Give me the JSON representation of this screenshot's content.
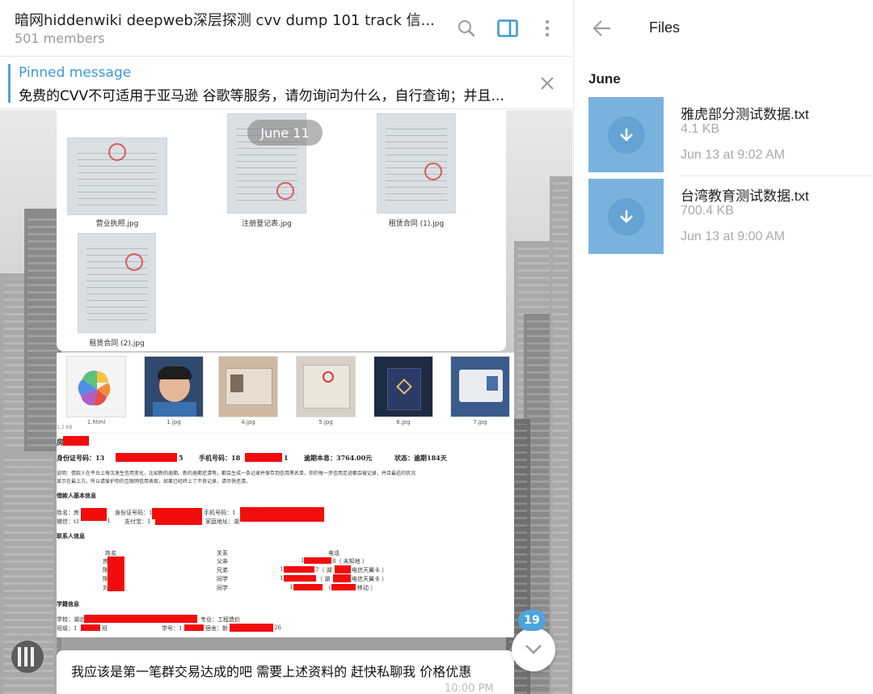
{
  "chat": {
    "title": "暗网hiddenwiki deepweb深层探测 cvv dump 101 track 信...",
    "members": "501 members",
    "pinned_title": "Pinned message",
    "pinned_text": "免费的CVV不可适用于亚马逊 谷歌等服务，请勿询问为什么，自行查询；并且...",
    "date_pill": "June 11",
    "doc_captions": [
      "营业执照.jpg",
      "注册登记表.jpg",
      "租赁合同 (1).jpg",
      "租赁合同 (2).jpg"
    ],
    "strip_captions": [
      "1.html",
      "1.jpg",
      "4.jpg",
      "5.jpg",
      "6.jpg",
      "7.jpg"
    ],
    "strip_size": "1.2 KB",
    "message_text": "我应该是第一笔群交易达成的吧  需要上述资料的 赶快私聊我 价格优惠",
    "message_time": "10:00 PM",
    "unread_count": "19"
  },
  "doc": {
    "id_label": "身份证号码：13",
    "id_tail": "5",
    "phone_label": "手机号码：18",
    "phone_tail": "1",
    "due_label": "逾期本息：3764.00元",
    "status_label": "状态：逾期184天",
    "note_line1": "说明：借款人在平台上每次发生信用变化，比如新的逾期、新的逾期还清等，都会生成一条记录并保存到信用黑名单，你的每一步信用足迹都会被记录，并且最近的状况",
    "note_line2": "显示在最上方。所以请爱护你的互联网信用表现，如果已经终上了不良记录，请尽快还清。",
    "section_basic": "借款人基本信息",
    "basic_row1_a": "姓名：房",
    "basic_row1_b": "身份证号码：1",
    "basic_row1_c": "手机号码：1",
    "basic_row2_a": "微信：t1",
    "basic_row2_b": "1",
    "basic_row2_c": "支付宝：1",
    "basic_row2_d": "家庭地址：湖",
    "section_contacts": "联系人信息",
    "contact_head": [
      "姓名",
      "关系",
      "电话"
    ],
    "contact_rel": [
      "父亲",
      "兄弟",
      "同学",
      "同学"
    ],
    "contact_phone": [
      {
        "pre": "1",
        "post": "8（ 未知地 ）"
      },
      {
        "pre": "1",
        "post": "7（ 湖",
        "carrier": "电信天翼卡 ）"
      },
      {
        "pre": "1",
        "post": "（ 湖",
        "carrier": "电信天翼卡 ）"
      },
      {
        "pre": "1",
        "post": "（",
        "carrier": "移动 ）"
      }
    ],
    "contact_names": [
      "房",
      "陈",
      "陈",
      "刘"
    ],
    "section_edu": "学籍信息",
    "edu_row1_a": "学校：湖北",
    "edu_row1_b": "专业：工程造价",
    "edu_row2_a": "班级：1",
    "edu_row2_b": "班",
    "edu_row2_c": "学号：1",
    "edu_row2_d": "宿舍：新",
    "edu_row2_e": "26",
    "name_prefix": "房"
  },
  "files": {
    "title": "Files",
    "month": "June",
    "items": [
      {
        "name": "雅虎部分测试数据.txt",
        "size": "4.1 KB",
        "date": "Jun 13 at 9:02 AM"
      },
      {
        "name": "台湾教育测试数据.txt",
        "size": "700.4 KB",
        "date": "Jun 13 at 9:00 AM"
      }
    ]
  },
  "colors": {
    "accent": "#4ea4dc",
    "file_tile": "#79b3dd",
    "redaction": "#f20d0d"
  },
  "icons": [
    "search-icon",
    "sidebar-toggle-icon",
    "more-vert-icon",
    "close-icon",
    "arrow-left-icon",
    "download-icon",
    "chevron-down-icon"
  ]
}
